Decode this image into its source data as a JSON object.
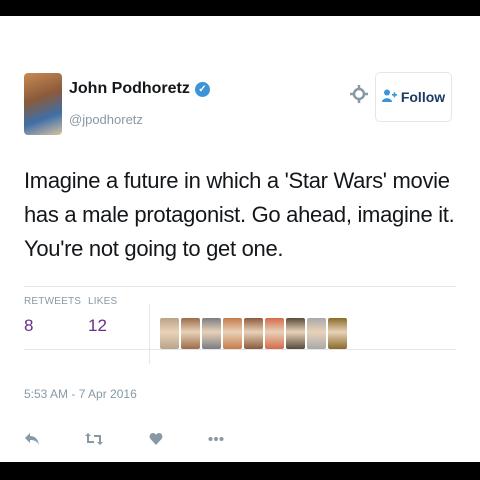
{
  "user": {
    "name": "John Podhoretz",
    "handle": "@jpodhoretz"
  },
  "follow_button": {
    "label": "Follow"
  },
  "tweet": {
    "lines": [
      "Imagine a future in which a 'Star Wars' movie",
      "has a male protagonist. Go ahead, imagine it.",
      "You're not going to get one."
    ]
  },
  "stats": {
    "retweets_label": "RETWEETS",
    "retweets_value": "8",
    "likes_label": "LIKES",
    "likes_value": "12"
  },
  "liker_colors": [
    "#b9a48a",
    "#9c6b4a",
    "#7c7c82",
    "#c77a4a",
    "#8b5a3c",
    "#d46a4a",
    "#5a4a3a",
    "#a9a9a9",
    "#8a6a2a"
  ],
  "timestamp": "5:53 AM - 7 Apr 2016",
  "actions": {
    "reply_icon": "reply-icon",
    "retweet_icon": "retweet-icon",
    "like_icon": "heart-icon",
    "more_icon": "more-icon"
  },
  "colors": {
    "stat_value": "#6b2d8c",
    "verified": "#3b94d9",
    "muted": "#8899a6"
  }
}
